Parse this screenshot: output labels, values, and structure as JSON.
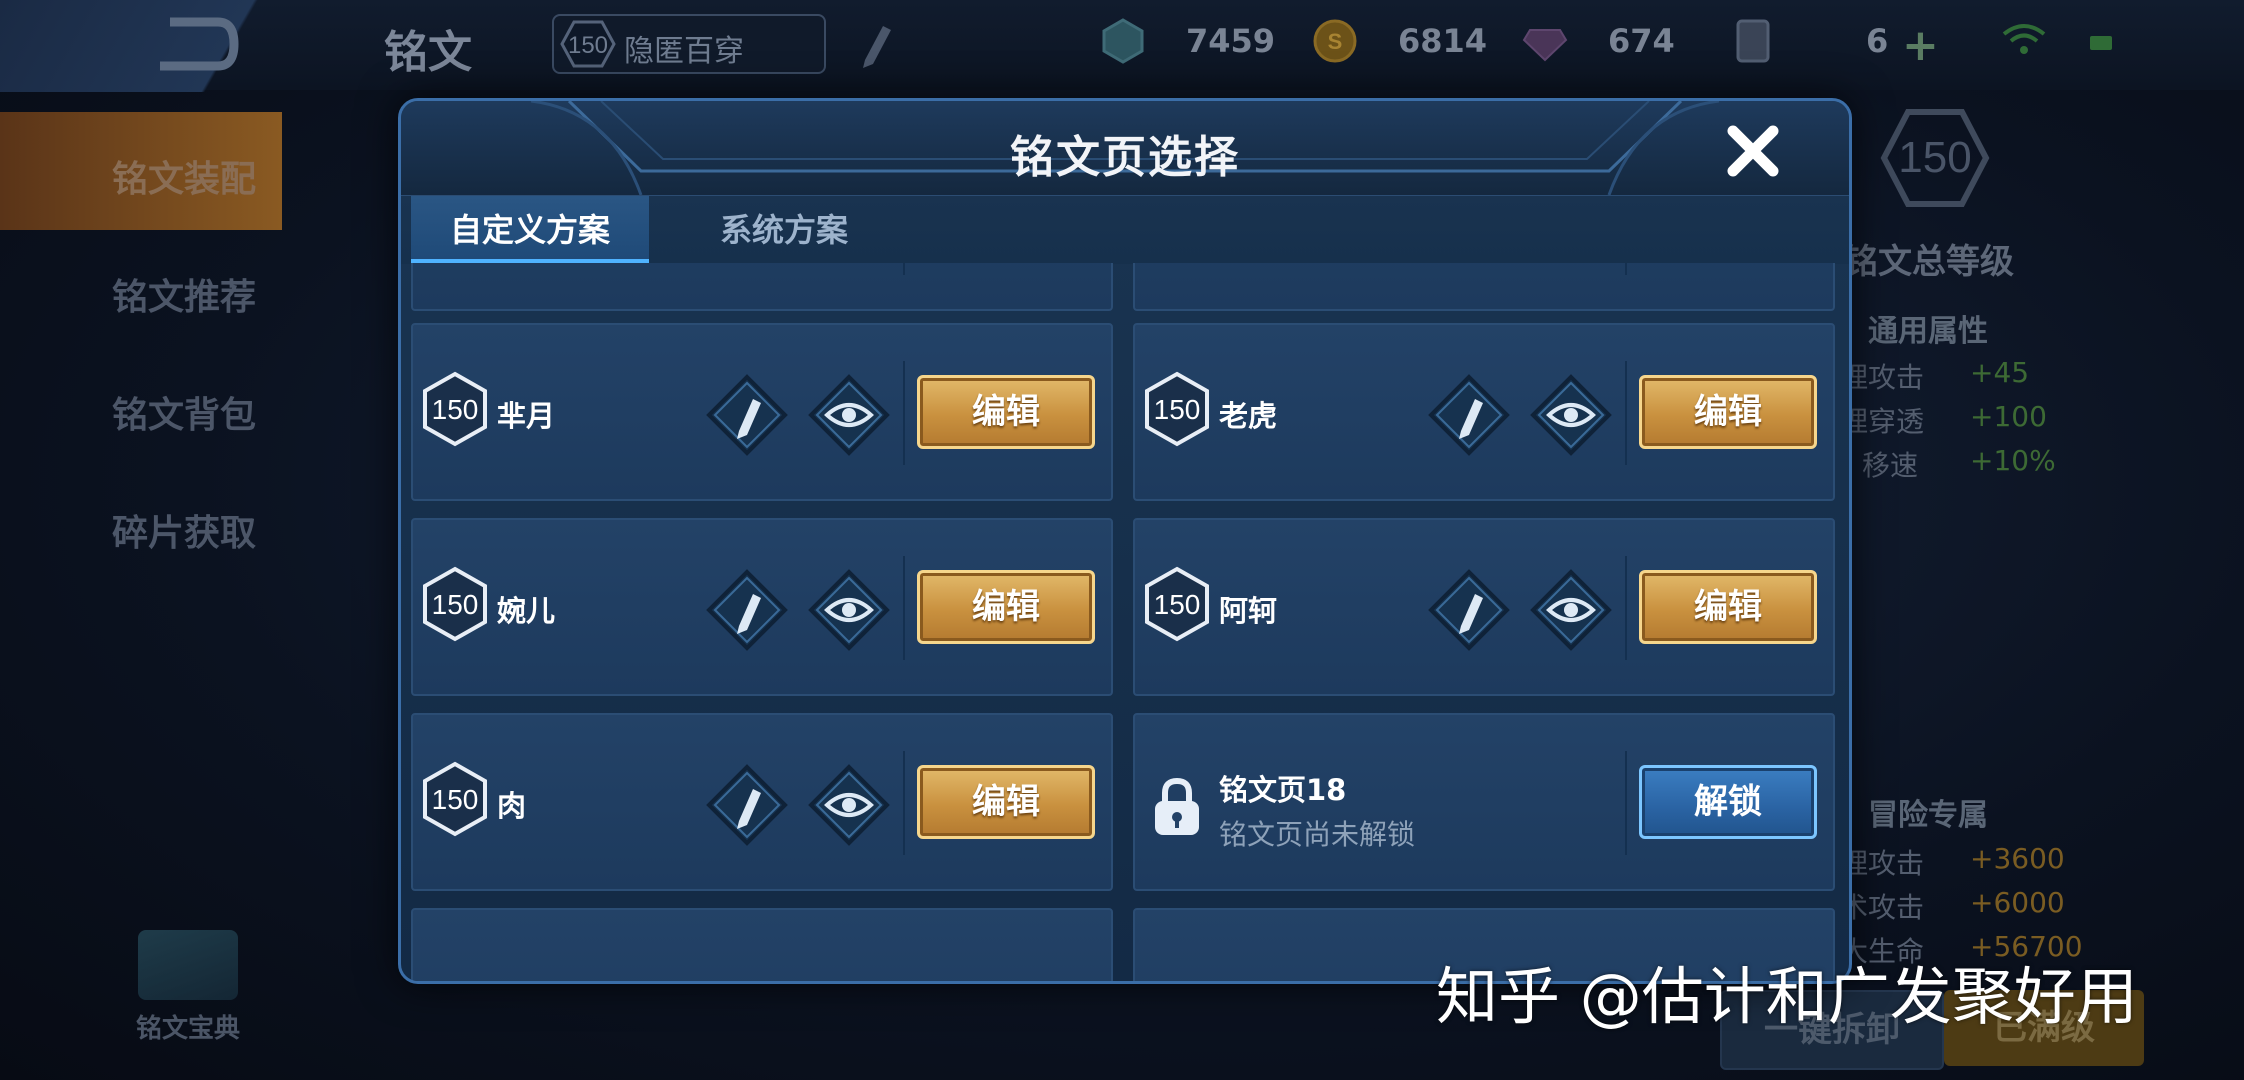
{
  "top_bar": {
    "title": "铭文",
    "page_level": "150",
    "page_name": "隐匿百穿",
    "resources": [
      {
        "icon": "crystal-icon",
        "value": "7459"
      },
      {
        "icon": "gold-coin-icon",
        "value": "6814"
      },
      {
        "icon": "purple-gem-icon",
        "value": "674"
      },
      {
        "icon": "card-icon",
        "value": "6"
      }
    ]
  },
  "side_nav": {
    "items": [
      {
        "label": "铭文装配",
        "active": true
      },
      {
        "label": "铭文推荐",
        "active": false
      },
      {
        "label": "铭文背包",
        "active": false
      },
      {
        "label": "碎片获取",
        "active": false
      }
    ],
    "codex_label": "铭文宝典"
  },
  "right_panel": {
    "total_level": "150",
    "total_level_label": "铭文总等级",
    "common_title": "通用属性",
    "common_attrs": [
      {
        "name": "理攻击",
        "value": "+45"
      },
      {
        "name": "理穿透",
        "value": "+100"
      },
      {
        "name": "移速",
        "value": "+10%"
      }
    ],
    "adventure_title": "冒险专属",
    "adventure_attrs": [
      {
        "name": "理攻击",
        "value": "+3600"
      },
      {
        "name": "术攻击",
        "value": "+6000"
      },
      {
        "name": "大生命",
        "value": "+56700"
      }
    ],
    "unload_label": "一键拆卸",
    "full_label": "已满级"
  },
  "modal": {
    "title": "铭文页选择",
    "tabs": [
      {
        "label": "自定义方案",
        "active": true
      },
      {
        "label": "系统方案",
        "active": false
      }
    ],
    "edit_label": "编辑",
    "pages": [
      {
        "level": "150",
        "name": "芈月"
      },
      {
        "level": "150",
        "name": "老虎"
      },
      {
        "level": "150",
        "name": "婉儿"
      },
      {
        "level": "150",
        "name": "阿轲"
      },
      {
        "level": "150",
        "name": "肉"
      }
    ],
    "locked_page": {
      "name": "铭文页18",
      "status": "铭文页尚未解锁",
      "button": "解锁"
    }
  },
  "watermark": "知乎 @估计和广发聚好用",
  "colors": {
    "accent_gold": "#d4a34e",
    "accent_blue": "#4fb3ff",
    "card_bg": "#234267",
    "modal_border": "#3b6ea8"
  }
}
